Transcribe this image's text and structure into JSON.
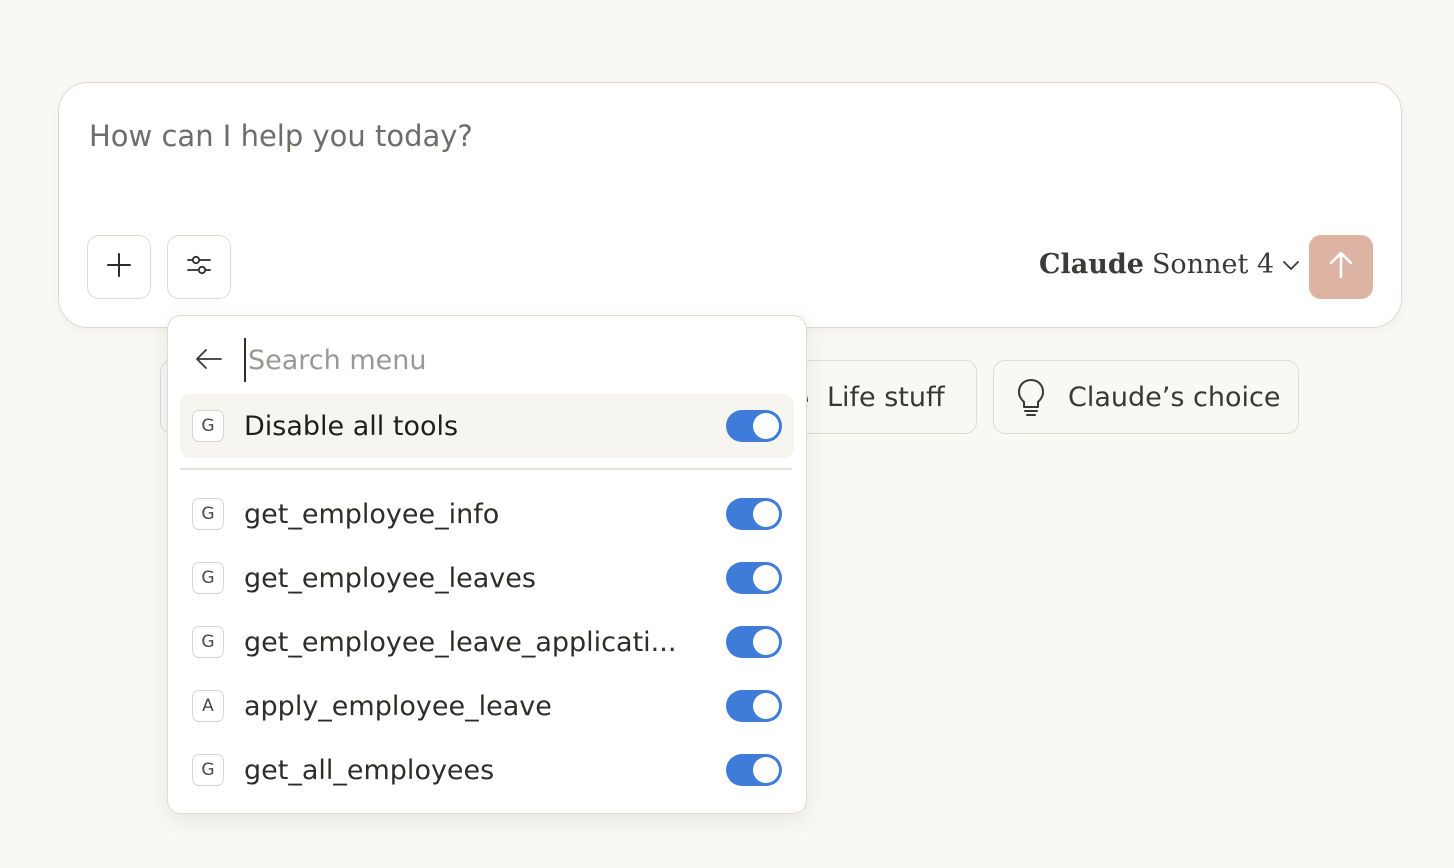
{
  "composer": {
    "placeholder": "How can I help you today?",
    "add_icon": "plus-icon",
    "tools_icon": "sliders-icon",
    "model": {
      "brand": "Claude",
      "name": "Sonnet 4",
      "chevron_icon": "chevron-down-icon"
    },
    "send_icon": "arrow-up-icon",
    "send_color": "#ddb3a4"
  },
  "chips": [
    {
      "label": "Life stuff",
      "icon": "coffee-icon"
    },
    {
      "label": "Claude’s choice",
      "icon": "lightbulb-icon"
    }
  ],
  "tools_menu": {
    "back_icon": "arrow-left-icon",
    "search_placeholder": "Search menu",
    "disable_all": {
      "label": "Disable all tools",
      "badge": "G",
      "enabled": true
    },
    "tools": [
      {
        "badge": "G",
        "label": "get_employee_info",
        "enabled": true
      },
      {
        "badge": "G",
        "label": "get_employee_leaves",
        "enabled": true
      },
      {
        "badge": "G",
        "label": "get_employee_leave_applicati...",
        "enabled": true
      },
      {
        "badge": "A",
        "label": "apply_employee_leave",
        "enabled": true
      },
      {
        "badge": "G",
        "label": "get_all_employees",
        "enabled": true
      }
    ],
    "toggle_color": "#3f7bd9"
  }
}
